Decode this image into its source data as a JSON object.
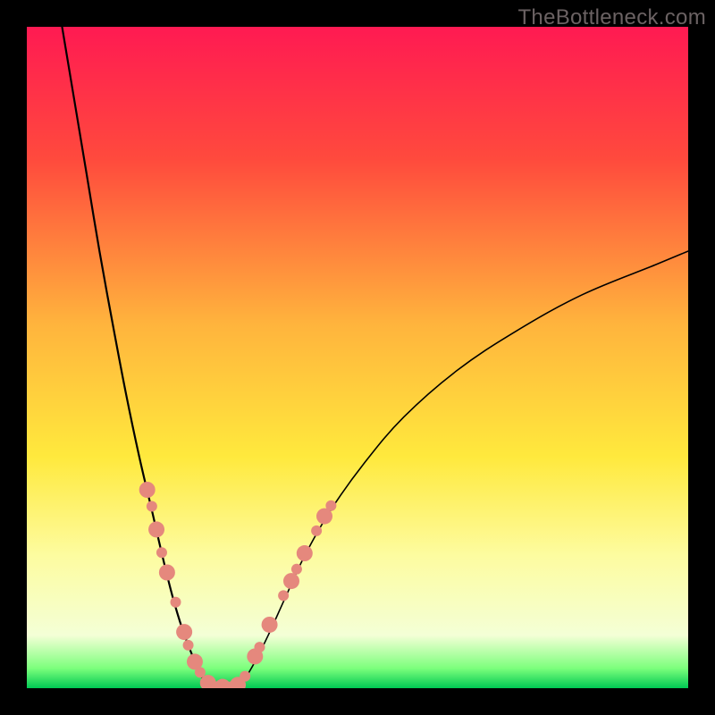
{
  "watermark": "TheBottleneck.com",
  "chart_data": {
    "type": "line",
    "title": "",
    "xlabel": "",
    "ylabel": "",
    "xlim": [
      0,
      100
    ],
    "ylim": [
      0,
      100
    ],
    "gradient_stops": [
      {
        "offset": 0,
        "color": "#ff1a52"
      },
      {
        "offset": 20,
        "color": "#ff4a3d"
      },
      {
        "offset": 45,
        "color": "#ffb43d"
      },
      {
        "offset": 65,
        "color": "#ffe93d"
      },
      {
        "offset": 80,
        "color": "#fdfca0"
      },
      {
        "offset": 92,
        "color": "#f4ffd6"
      },
      {
        "offset": 97,
        "color": "#7cff7c"
      },
      {
        "offset": 100,
        "color": "#00c853"
      }
    ],
    "series": [
      {
        "name": "left-curve",
        "x": [
          5,
          7,
          9,
          11,
          13,
          15,
          17,
          19,
          20.5,
          22,
          23.5,
          25,
          26,
          27,
          27.8
        ],
        "y": [
          102,
          90,
          78,
          66,
          55,
          44.5,
          35,
          26.5,
          20,
          14,
          9,
          5,
          2.5,
          1,
          0.2
        ],
        "color": "#000000",
        "weight": 2.2
      },
      {
        "name": "valley-floor",
        "x": [
          27.8,
          28.6,
          29.4,
          30.2,
          31,
          31.8
        ],
        "y": [
          0.2,
          0.0,
          0.0,
          0.0,
          0.0,
          0.2
        ],
        "color": "#000000",
        "weight": 2.2
      },
      {
        "name": "right-curve",
        "x": [
          31.8,
          33,
          34.5,
          36.5,
          39,
          42,
          46,
          51,
          57,
          65,
          74,
          84,
          95,
          101
        ],
        "y": [
          0.2,
          1.5,
          4,
          8,
          13.5,
          20,
          27,
          34,
          41,
          48,
          54,
          59.5,
          64,
          66.5
        ],
        "color": "#000000",
        "weight": 1.6
      }
    ],
    "markers": {
      "name": "salmon-points",
      "color": "#e5887d",
      "radius_major": 9,
      "radius_minor": 6,
      "points": [
        {
          "x": 18.2,
          "y": 30.0,
          "r": "major"
        },
        {
          "x": 18.9,
          "y": 27.5,
          "r": "minor"
        },
        {
          "x": 19.6,
          "y": 24.0,
          "r": "major"
        },
        {
          "x": 20.4,
          "y": 20.5,
          "r": "minor"
        },
        {
          "x": 21.2,
          "y": 17.5,
          "r": "major"
        },
        {
          "x": 22.5,
          "y": 13.0,
          "r": "minor"
        },
        {
          "x": 23.8,
          "y": 8.5,
          "r": "major"
        },
        {
          "x": 24.4,
          "y": 6.5,
          "r": "minor"
        },
        {
          "x": 25.4,
          "y": 4.0,
          "r": "major"
        },
        {
          "x": 26.2,
          "y": 2.4,
          "r": "minor"
        },
        {
          "x": 27.4,
          "y": 0.8,
          "r": "major"
        },
        {
          "x": 28.5,
          "y": 0.2,
          "r": "minor"
        },
        {
          "x": 29.6,
          "y": 0.2,
          "r": "major"
        },
        {
          "x": 30.8,
          "y": 0.2,
          "r": "minor"
        },
        {
          "x": 31.9,
          "y": 0.5,
          "r": "major"
        },
        {
          "x": 33.0,
          "y": 1.8,
          "r": "minor"
        },
        {
          "x": 34.5,
          "y": 4.8,
          "r": "major"
        },
        {
          "x": 35.2,
          "y": 6.2,
          "r": "minor"
        },
        {
          "x": 36.7,
          "y": 9.6,
          "r": "major"
        },
        {
          "x": 38.8,
          "y": 14.0,
          "r": "minor"
        },
        {
          "x": 40.0,
          "y": 16.2,
          "r": "major"
        },
        {
          "x": 40.8,
          "y": 18.0,
          "r": "minor"
        },
        {
          "x": 42.0,
          "y": 20.4,
          "r": "major"
        },
        {
          "x": 43.8,
          "y": 23.8,
          "r": "minor"
        },
        {
          "x": 45.0,
          "y": 26.0,
          "r": "major"
        },
        {
          "x": 46.0,
          "y": 27.6,
          "r": "minor"
        }
      ]
    }
  }
}
